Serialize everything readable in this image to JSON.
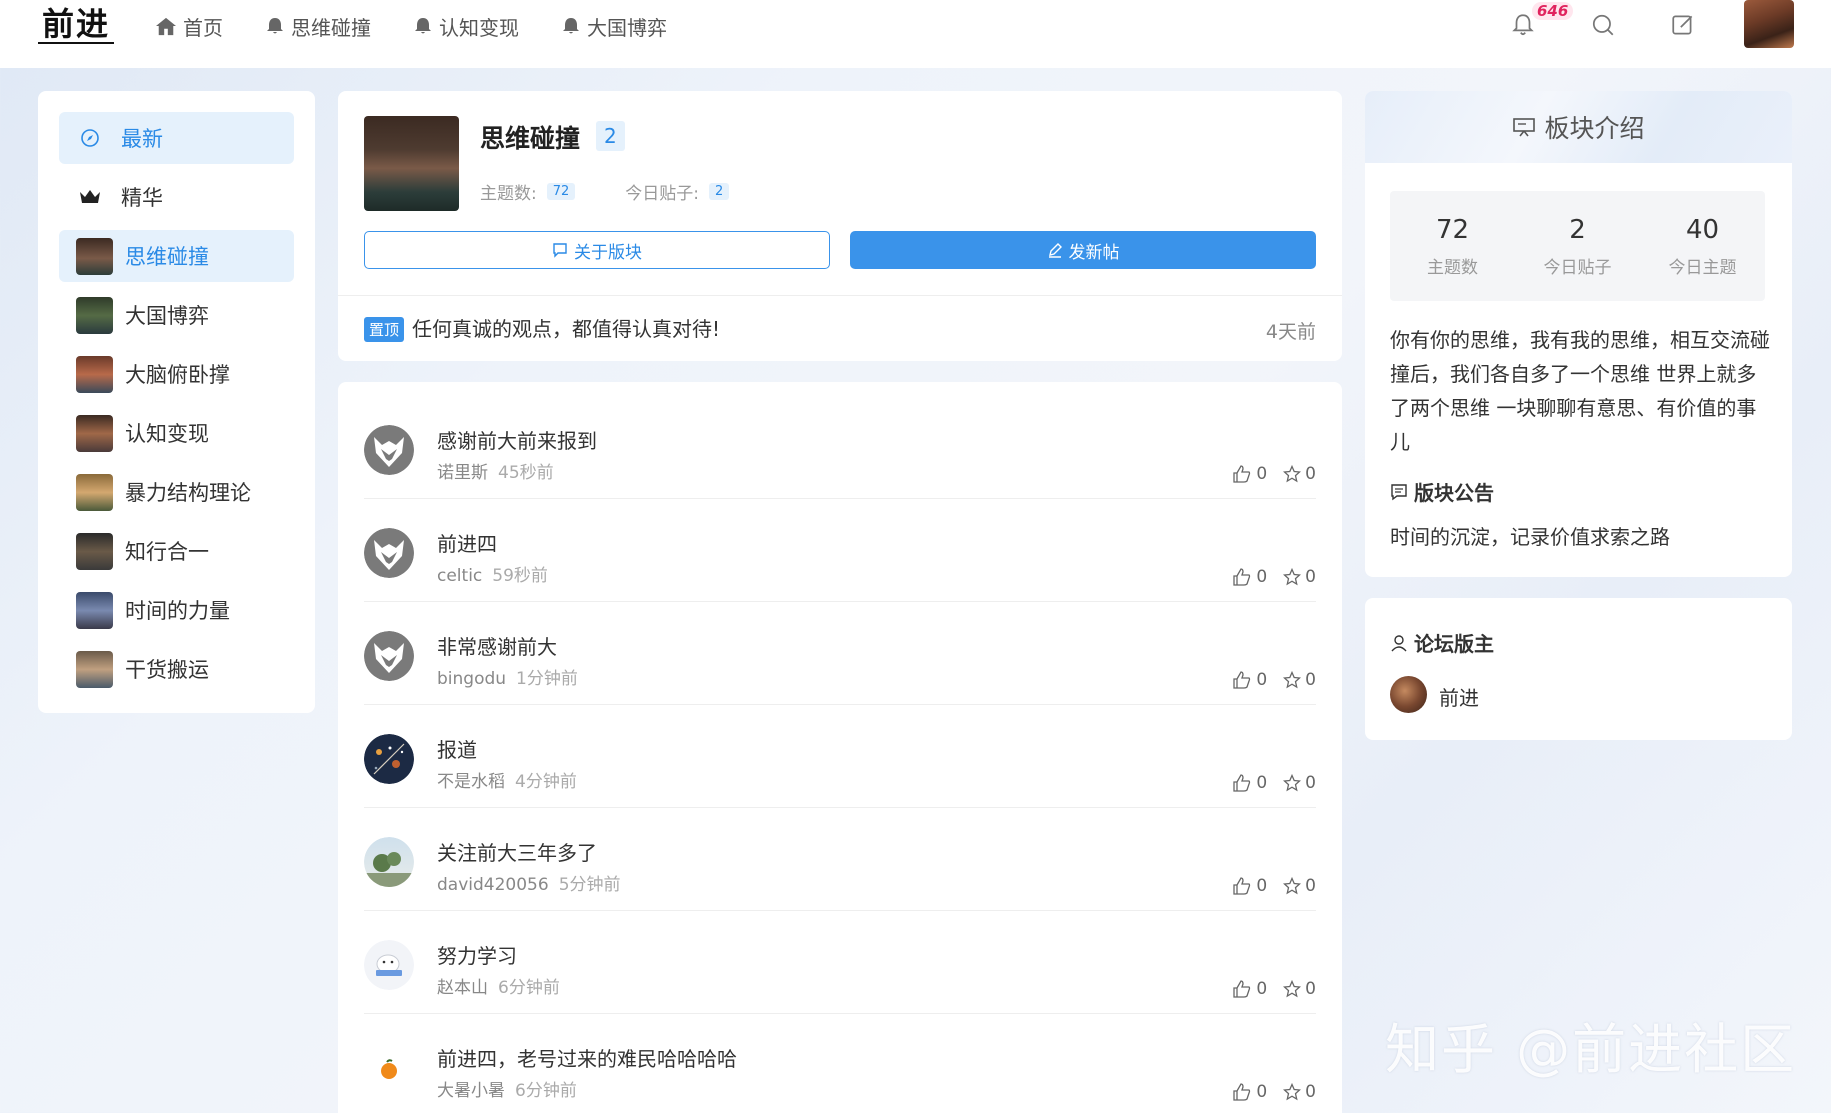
{
  "header": {
    "logo": "前进",
    "nav": [
      {
        "label": "首页",
        "icon": "home-icon"
      },
      {
        "label": "思维碰撞",
        "icon": "bell-icon"
      },
      {
        "label": "认知变现",
        "icon": "bell-icon"
      },
      {
        "label": "大国博弈",
        "icon": "bell-icon"
      }
    ],
    "notification_count": "646"
  },
  "sidebar": {
    "items": [
      {
        "label": "最新",
        "active": true
      },
      {
        "label": "精华"
      },
      {
        "label": "思维碰撞",
        "active": true
      },
      {
        "label": "大国博弈"
      },
      {
        "label": "大脑俯卧撑"
      },
      {
        "label": "认知变现"
      },
      {
        "label": "暴力结构理论"
      },
      {
        "label": "知行合一"
      },
      {
        "label": "时间的力量"
      },
      {
        "label": "干货搬运"
      }
    ]
  },
  "board": {
    "title": "思维碰撞",
    "number": "2",
    "topics_label": "主题数:",
    "topics_value": "72",
    "today_posts_label": "今日贴子:",
    "today_posts_value": "2",
    "about_button": "关于版块",
    "post_button": "发新帖",
    "pinned_tag": "置顶",
    "pinned_text": "任何真诚的观点，都值得认真对待!",
    "pinned_time": "4天前"
  },
  "posts": [
    {
      "title": "感谢前大前来报到",
      "author": "诺里斯",
      "time": "45秒前",
      "likes": "0",
      "stars": "0"
    },
    {
      "title": "前进四",
      "author": "celtic",
      "time": "59秒前",
      "likes": "0",
      "stars": "0"
    },
    {
      "title": "非常感谢前大",
      "author": "bingodu",
      "time": "1分钟前",
      "likes": "0",
      "stars": "0"
    },
    {
      "title": "报道",
      "author": "不是水稻",
      "time": "4分钟前",
      "likes": "0",
      "stars": "0"
    },
    {
      "title": "关注前大三年多了",
      "author": "david420056",
      "time": "5分钟前",
      "likes": "0",
      "stars": "0"
    },
    {
      "title": "努力学习",
      "author": "赵本山",
      "time": "6分钟前",
      "likes": "0",
      "stars": "0"
    },
    {
      "title": "前进四，老号过来的难民哈哈哈哈",
      "author": "大暑小暑",
      "time": "6分钟前",
      "likes": "0",
      "stars": "0"
    }
  ],
  "intro": {
    "title": "板块介绍",
    "stats": [
      {
        "value": "72",
        "label": "主题数"
      },
      {
        "value": "2",
        "label": "今日贴子"
      },
      {
        "value": "40",
        "label": "今日主题"
      }
    ],
    "description": "你有你的思维，我有我的思维，相互交流碰撞后，我们各自多了一个思维 世界上就多了两个思维 一块聊聊有意思、有价值的事儿",
    "notice_title": "版块公告",
    "notice_text": "时间的沉淀，记录价值求索之路"
  },
  "moderators": {
    "title": "论坛版主",
    "name": "前进"
  },
  "watermark": "知乎 @前进社区",
  "colors": {
    "accent": "#3a93ea",
    "accent_light": "#e5f1fc",
    "badge": "#e0245e"
  }
}
